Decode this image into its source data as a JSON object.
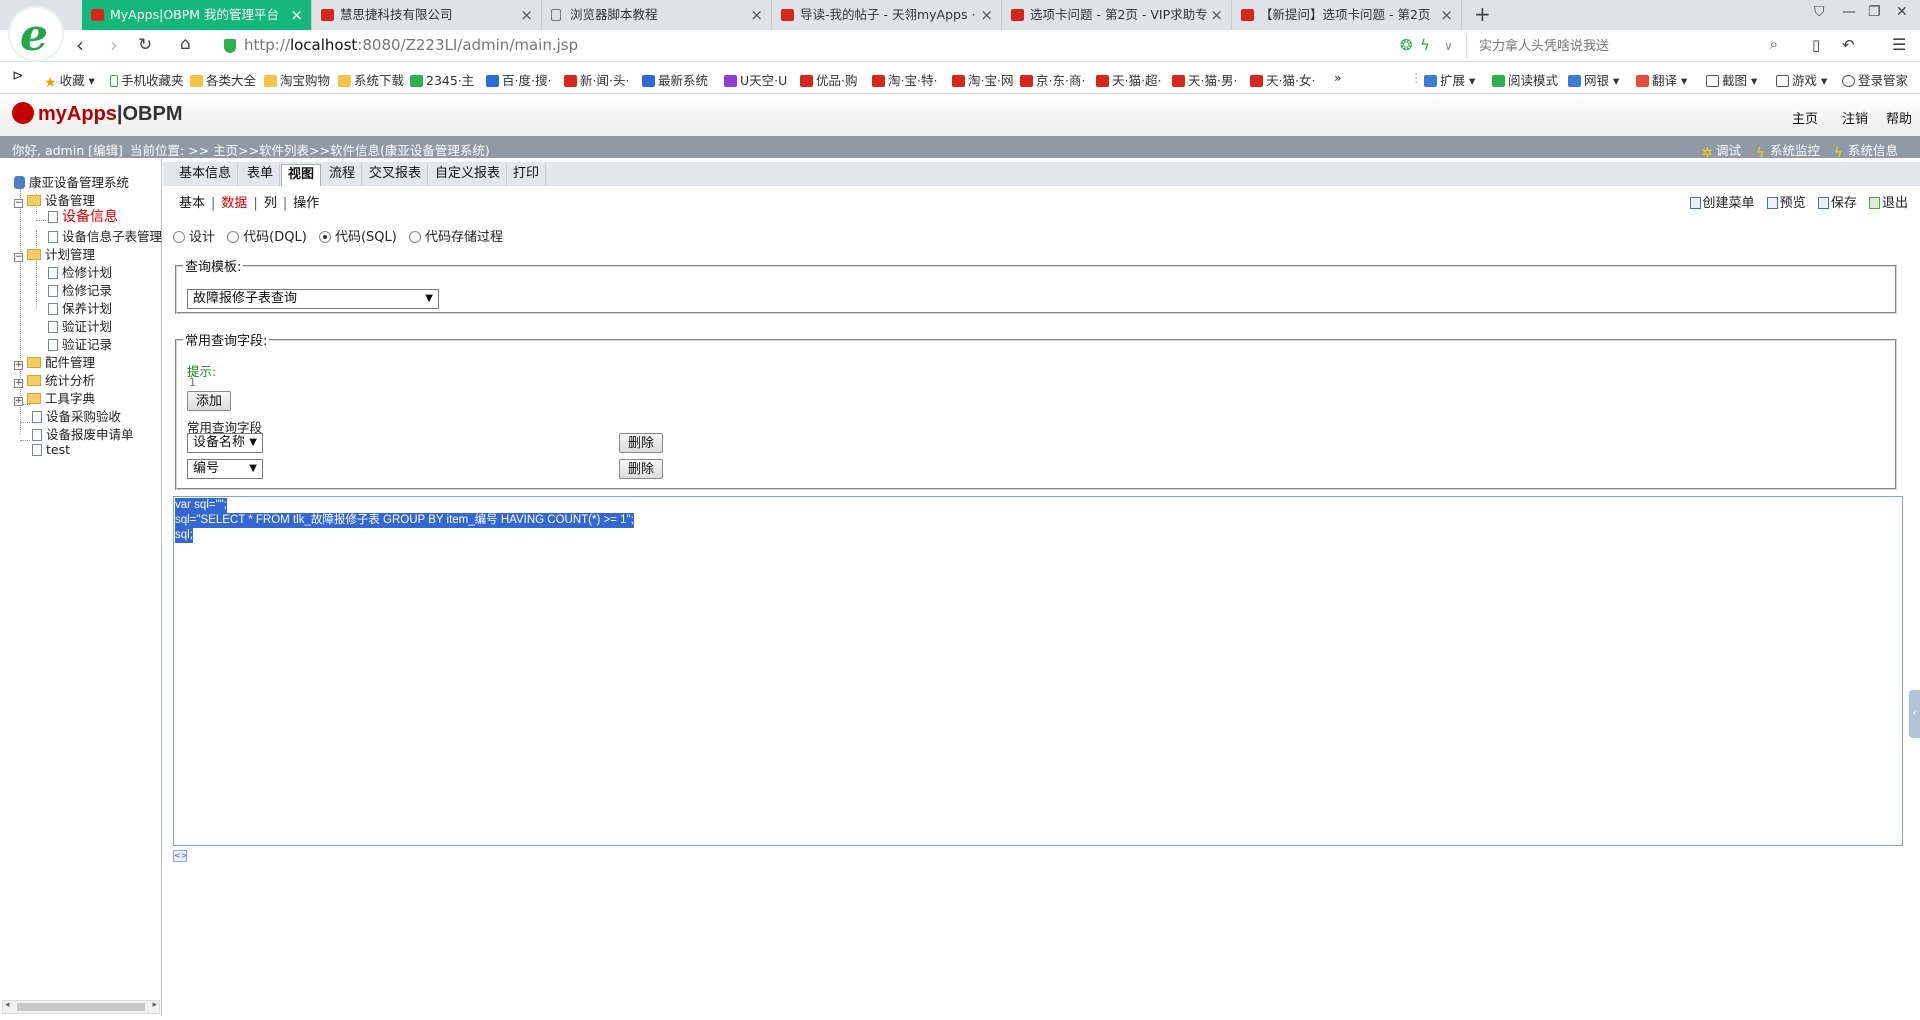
{
  "browser": {
    "tabs": [
      {
        "label": "MyApps|OBPM 我的管理平台",
        "active": true
      },
      {
        "label": "慧思捷科技有限公司",
        "active": false
      },
      {
        "label": "浏览器脚本教程",
        "active": false
      },
      {
        "label": "导读-我的帖子 - 天翎myApps ·",
        "active": false
      },
      {
        "label": "选项卡问题 - 第2页 - VIP求助专",
        "active": false
      },
      {
        "label": "【新提问】选项卡问题 - 第2页",
        "active": false
      }
    ],
    "url_prefix": "http://",
    "url_host": "localhost",
    "url_rest": ":8080/Z223LI/admin/main.jsp",
    "search_placeholder": "实力拿人头凭啥说我送",
    "favorites": [
      "收藏",
      "手机收藏夹",
      "各类大全",
      "淘宝购物",
      "系统下载",
      "2345·主",
      "百·度·搜·",
      "新·闻·头·",
      "最新系统",
      "U天空·U",
      "优品·购",
      "淘·宝·特·",
      "淘·宝·网",
      "京·东·商·",
      "天·猫·超·",
      "天·猫·男·",
      "天·猫·女·",
      "»"
    ],
    "right_tools": [
      "扩展",
      "阅读模式",
      "网银",
      "翻译",
      "截图",
      "游戏",
      "登录管家"
    ]
  },
  "app": {
    "logo_brand": "myApps",
    "logo_suffix": "|OBPM",
    "top_nav": [
      "主页",
      "注销",
      "帮助"
    ],
    "greeting": "你好, admin [编辑]",
    "breadcrumb": "当前位置: >> 主页>>软件列表>>软件信息(康亚设备管理系统)",
    "info_tools": [
      "调试",
      "系统监控",
      "系统信息"
    ]
  },
  "tree": {
    "root": "康亚设备管理系统",
    "nodes": [
      {
        "label": "设备管理",
        "level": 1,
        "type": "folder",
        "expanded": true
      },
      {
        "label": "设备信息",
        "level": 2,
        "type": "page",
        "selected": true
      },
      {
        "label": "设备信息子表管理",
        "level": 2,
        "type": "page"
      },
      {
        "label": "计划管理",
        "level": 1,
        "type": "folder",
        "expanded": true
      },
      {
        "label": "检修计划",
        "level": 2,
        "type": "page"
      },
      {
        "label": "检修记录",
        "level": 2,
        "type": "page"
      },
      {
        "label": "保养计划",
        "level": 2,
        "type": "page"
      },
      {
        "label": "验证计划",
        "level": 2,
        "type": "page"
      },
      {
        "label": "验证记录",
        "level": 2,
        "type": "page"
      },
      {
        "label": "配件管理",
        "level": 1,
        "type": "folder",
        "expanded": false
      },
      {
        "label": "统计分析",
        "level": 1,
        "type": "folder",
        "expanded": false
      },
      {
        "label": "工具字典",
        "level": 1,
        "type": "folder",
        "expanded": false
      },
      {
        "label": "设备采购验收",
        "level": 1,
        "type": "page"
      },
      {
        "label": "设备报废申请单",
        "level": 1,
        "type": "page"
      },
      {
        "label": "test",
        "level": 1,
        "type": "page"
      }
    ]
  },
  "main_tabs": [
    "基本信息",
    "表单",
    "视图",
    "流程",
    "交叉报表",
    "自定义报表",
    "打印"
  ],
  "active_main_tab": "视图",
  "sub_tabs": [
    "基本",
    "数据",
    "列",
    "操作"
  ],
  "active_sub_tab": "数据",
  "actions": [
    "创建菜单",
    "预览",
    "保存",
    "退出"
  ],
  "modes": [
    {
      "label": "设计",
      "checked": false
    },
    {
      "label": "代码(DQL)",
      "checked": false
    },
    {
      "label": "代码(SQL)",
      "checked": true
    },
    {
      "label": "代码存储过程",
      "checked": false
    }
  ],
  "query_template": {
    "legend": "查询模板:",
    "selected": "故障报修子表查询"
  },
  "common_fields": {
    "legend": "常用查询字段:",
    "hint_label": "提示:",
    "hint_value": "1",
    "add_label": "添加",
    "section_label": "常用查询字段",
    "rows": [
      {
        "field": "设备名称",
        "delete_label": "删除"
      },
      {
        "field": "编号",
        "delete_label": "删除"
      }
    ]
  },
  "sql_code": [
    "var sql=\"\";",
    "sql=\"SELECT * FROM tlk_故障报修子表 GROUP BY item_编号 HAVING COUNT(*) >= 1\";",
    "sql;"
  ],
  "colors": {
    "active_tab": "#16b77b",
    "selection": "#3367d6",
    "selected_tree": "#e00000",
    "info_bar": "#8f9aa6"
  }
}
